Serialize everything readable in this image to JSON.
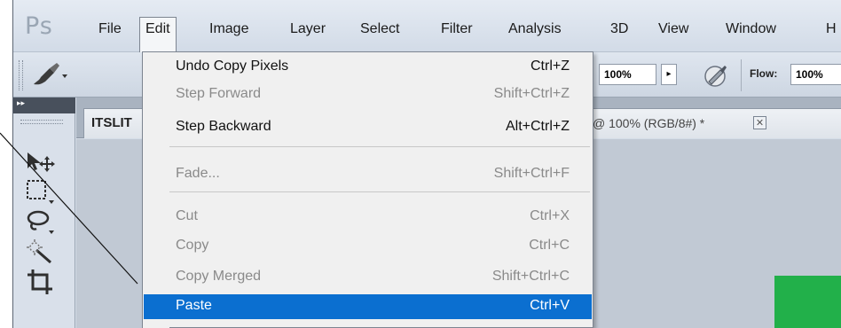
{
  "app": {
    "logo": "Ps"
  },
  "menubar": {
    "items": [
      "File",
      "Edit",
      "Image",
      "Layer",
      "Select",
      "Filter",
      "Analysis",
      "3D",
      "View",
      "Window",
      "H"
    ],
    "active": "Edit"
  },
  "options": {
    "opacity_value": "100%",
    "flow_label": "Flow:",
    "flow_value": "100%"
  },
  "document": {
    "tab_name": "ITSLIT",
    "tab_info": "@ 100% (RGB/8#) *",
    "close_glyph": "✕"
  },
  "edit_menu": {
    "items": [
      {
        "label": "Undo Copy Pixels",
        "shortcut": "Ctrl+Z",
        "state": "enabled"
      },
      {
        "label": "Step Forward",
        "shortcut": "Shift+Ctrl+Z",
        "state": "disabled"
      },
      {
        "label": "Step Backward",
        "shortcut": "Alt+Ctrl+Z",
        "state": "enabled"
      },
      {
        "label": "Fade...",
        "shortcut": "Shift+Ctrl+F",
        "state": "disabled"
      },
      {
        "label": "Cut",
        "shortcut": "Ctrl+X",
        "state": "disabled"
      },
      {
        "label": "Copy",
        "shortcut": "Ctrl+C",
        "state": "disabled"
      },
      {
        "label": "Copy Merged",
        "shortcut": "Shift+Ctrl+C",
        "state": "disabled"
      },
      {
        "label": "Paste",
        "shortcut": "Ctrl+V",
        "state": "highlighted"
      }
    ]
  },
  "tools": [
    "move-tool-icon",
    "marquee-tool-icon",
    "lasso-tool-icon",
    "magic-wand-tool-icon",
    "crop-tool-icon"
  ],
  "colors": {
    "menu_highlight": "#0b6fd0",
    "canvas_green": "#22b04a",
    "panel_dark": "#48505c"
  }
}
